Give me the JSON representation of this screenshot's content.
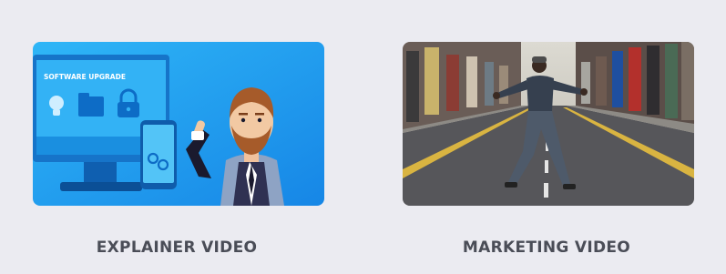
{
  "cards": [
    {
      "id": "explainer",
      "caption": "EXPLAINER VIDEO",
      "screen_text": "SOFTWARE UPGRADE"
    },
    {
      "id": "marketing",
      "caption": "MARKETING VIDEO"
    }
  ],
  "colors": {
    "page_background": "#ebebf1",
    "caption_text": "#4a4d57",
    "explainer_blue": "#1c9ff2"
  }
}
